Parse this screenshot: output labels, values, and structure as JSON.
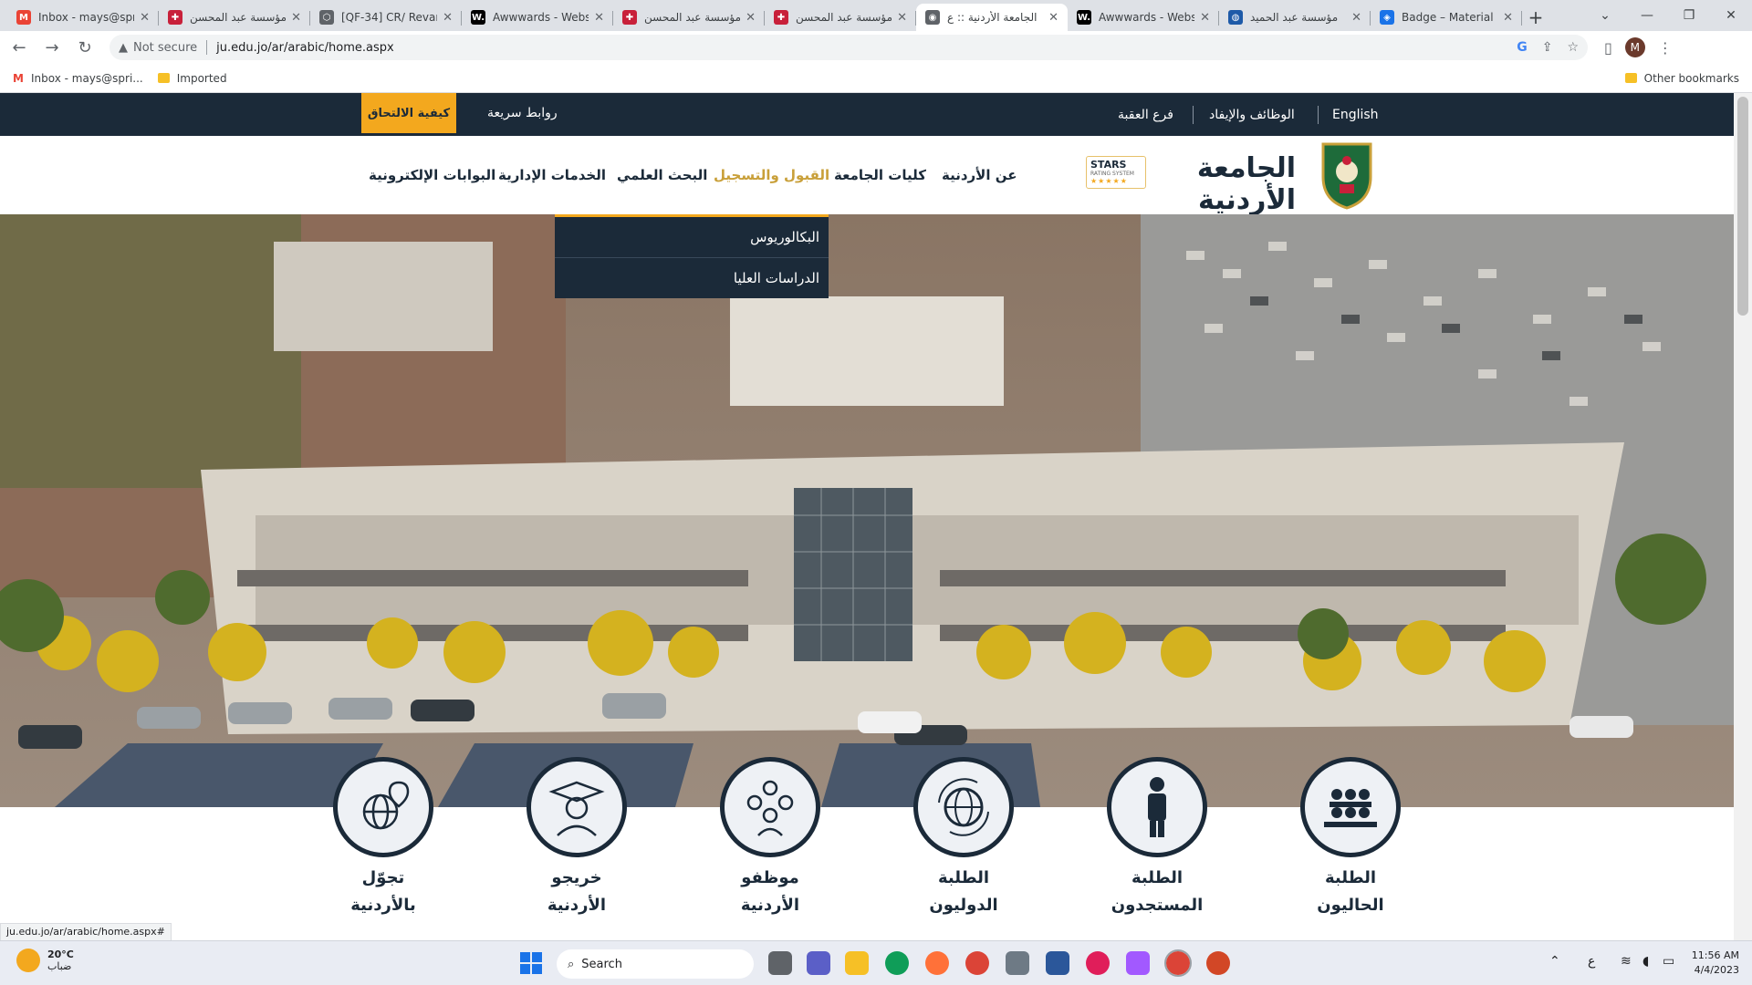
{
  "browser": {
    "tabs": [
      {
        "title": "Inbox - mays@spri",
        "favicon": "gmail-icon",
        "color": "#ea4335",
        "letter": "M"
      },
      {
        "title": "مؤسسة عبد المحسن",
        "favicon": "foundation-icon",
        "color": "#c8203a",
        "letter": "✚"
      },
      {
        "title": "[QF-34] CR/ Revam",
        "favicon": "jira-icon",
        "color": "#5f6368",
        "letter": "⬡"
      },
      {
        "title": "Awwwards - Websi",
        "favicon": "awwwards-icon",
        "color": "#000000",
        "letter": "W."
      },
      {
        "title": "مؤسسة عبد المحسن",
        "favicon": "foundation-icon",
        "color": "#c8203a",
        "letter": "✚"
      },
      {
        "title": "مؤسسة عبد المحسن",
        "favicon": "foundation-icon",
        "color": "#c8203a",
        "letter": "✚"
      },
      {
        "title": "الجامعة الأردنية :: ع",
        "favicon": "globe-icon",
        "color": "#5f6368",
        "letter": "◉",
        "active": true
      },
      {
        "title": "Awwwards - Websi",
        "favicon": "awwwards-icon",
        "color": "#000000",
        "letter": "W."
      },
      {
        "title": "مؤسسة عبد الحميد",
        "favicon": "shoman-icon",
        "color": "#1e5aa8",
        "letter": "◍"
      },
      {
        "title": "Badge – Material D",
        "favicon": "material-icon",
        "color": "#1a73e8",
        "letter": "◈"
      }
    ],
    "address": {
      "security": "Not secure",
      "url": "ju.edu.jo/ar/arabic/home.aspx"
    },
    "avatar_letter": "M",
    "bookmarks": [
      {
        "label": "Inbox - mays@spri..."
      },
      {
        "label": "Imported"
      }
    ],
    "other_bookmarks": "Other bookmarks",
    "status_url": "ju.edu.jo/ar/arabic/home.aspx#"
  },
  "site": {
    "top_links": {
      "english": "English",
      "jobs": "الوظائف والإيفاد",
      "aqaba": "فرع العقبة",
      "quick_links": "روابط سريعة",
      "how_to_join": "كيفية الالتحاق"
    },
    "logo_text": "الجامعة الأردنية",
    "stars_badge": {
      "title": "STARS",
      "subtitle": "RATING SYSTEM",
      "dots": "★★★★★"
    },
    "nav": [
      {
        "label": "عن الأردنية"
      },
      {
        "label": "كليات الجامعة"
      },
      {
        "label": "القبول والتسجيل",
        "active": true
      },
      {
        "label": "البحث العلمي"
      },
      {
        "label": "الخدمات الإدارية"
      },
      {
        "label": "البوابات الإلكترونية"
      }
    ],
    "dropdown": [
      {
        "label": "البكالوريوس"
      },
      {
        "label": "الدراسات العليا"
      }
    ],
    "categories": [
      {
        "line1": "الطلبة",
        "line2": "الحاليون",
        "icon": "students-group-icon"
      },
      {
        "line1": "الطلبة",
        "line2": "المستجدون",
        "icon": "new-student-icon"
      },
      {
        "line1": "الطلبة",
        "line2": "الدوليون",
        "icon": "global-students-icon"
      },
      {
        "line1": "موظفو",
        "line2": "الأردنية",
        "icon": "staff-icon"
      },
      {
        "line1": "خريجو",
        "line2": "الأردنية",
        "icon": "graduate-icon"
      },
      {
        "line1": "تجوّل",
        "line2": "بالأردنية",
        "icon": "tour-globe-icon"
      }
    ],
    "colors": {
      "navy": "#1b2a39",
      "gold": "#f3a81e",
      "green": "#1e6b3a"
    }
  },
  "taskbar": {
    "weather": {
      "temp": "20°C",
      "desc": "ضباب"
    },
    "search": "Search",
    "lang": "ع",
    "time": "11:56 AM",
    "date": "4/4/2023"
  }
}
